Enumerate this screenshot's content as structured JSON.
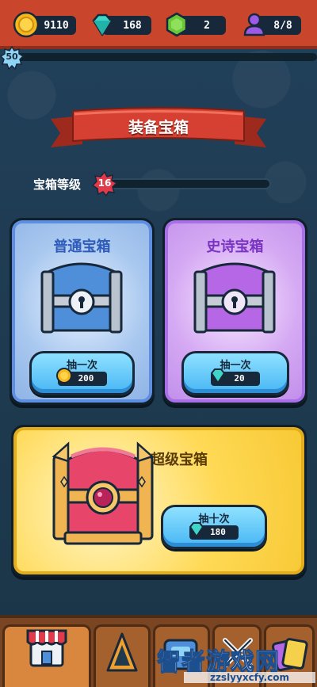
{
  "resources": {
    "coins": "9110",
    "gems": "168",
    "emeralds": "2",
    "players": "8/8"
  },
  "player_level": "50",
  "page_title": "装备宝箱",
  "chest_level": {
    "label": "宝箱等级",
    "value": "16"
  },
  "chests": {
    "normal": {
      "title": "普通宝箱",
      "button_label": "抽一次",
      "currency": "coin",
      "price": "200"
    },
    "epic": {
      "title": "史诗宝箱",
      "button_label": "抽一次",
      "currency": "gem",
      "price": "20"
    },
    "super": {
      "title": "超级宝箱",
      "button_label": "抽十次",
      "currency": "gem",
      "price": "180"
    }
  },
  "bottom_nav": [
    "shop",
    "heroes",
    "equipment",
    "battle",
    "cards"
  ],
  "watermark": {
    "text": "智者游戏网",
    "url": "zzslyyxcfy.com"
  },
  "colors": {
    "top_bar": "#c9462c",
    "normal_accent": "#5d8ee0",
    "epic_accent": "#a86fe6",
    "super_accent": "#f7c935",
    "button": "#47b6f4"
  }
}
